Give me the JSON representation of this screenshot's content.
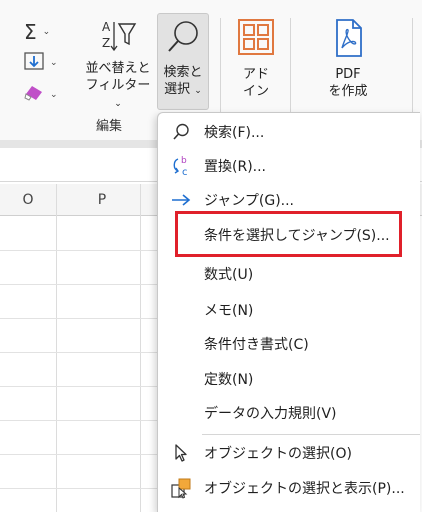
{
  "ribbon": {
    "sort_filter_label_line1": "並べ替えと",
    "sort_filter_label_line2": "フィルター",
    "find_select_label_line1": "検索と",
    "find_select_label_line2": "選択",
    "addin_label_line1": "アド",
    "addin_label_line2": "イン",
    "pdf_label_line1": "PDF",
    "pdf_label_line2": "を作成",
    "group_label": "編集",
    "accent_color": "#e07840"
  },
  "sheet": {
    "columns": [
      "O",
      "P"
    ]
  },
  "menu": {
    "items": [
      {
        "label": "検索(F)...",
        "icon": "search-icon"
      },
      {
        "label": "置換(R)...",
        "icon": "replace-icon"
      },
      {
        "label": "ジャンプ(G)...",
        "icon": "arrow-right-icon"
      },
      {
        "label": "条件を選択してジャンプ(S)...",
        "icon": ""
      },
      {
        "label": "数式(U)",
        "icon": ""
      },
      {
        "label": "メモ(N)",
        "icon": ""
      },
      {
        "label": "条件付き書式(C)",
        "icon": ""
      },
      {
        "label": "定数(N)",
        "icon": ""
      },
      {
        "label": "データの入力規則(V)",
        "icon": ""
      },
      {
        "label": "オブジェクトの選択(O)",
        "icon": "cursor-arrow-icon"
      },
      {
        "label": "オブジェクトの選択と表示(P)...",
        "icon": "selection-pane-icon"
      }
    ],
    "highlight_color": "#e0202a"
  }
}
